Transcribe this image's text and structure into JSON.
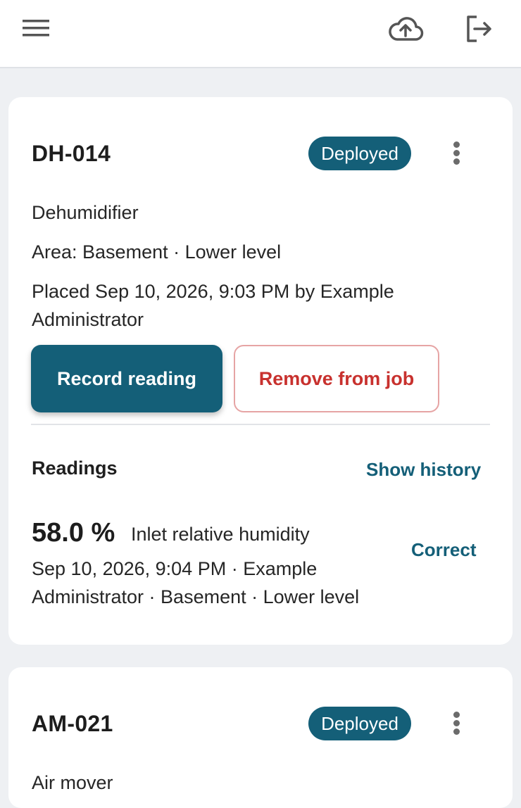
{
  "topbar": {
    "menu_icon": "hamburger-menu-icon",
    "upload_icon": "cloud-upload-icon",
    "logout_icon": "logout-icon"
  },
  "colors": {
    "accent": "#145f78",
    "danger": "#c8312e",
    "danger_border": "#e6a4a4",
    "background": "#eef0f3"
  },
  "cards": [
    {
      "id": "DH-014",
      "status": "Deployed",
      "type": "Dehumidifier",
      "area": "Area: Basement · Lower level",
      "placed_line1": "Placed Sep 10, 2026, 9:03 PM by Example",
      "placed_line2": "Administrator",
      "record_button": "Record reading",
      "remove_button": "Remove from job",
      "readings_title": "Readings",
      "show_history": "Show history",
      "reading": {
        "value": "58.0 %",
        "label": "Inlet relative humidity",
        "meta_line1": "Sep 10, 2026, 9:04 PM · Example",
        "meta_line2": "Administrator · Basement · Lower level",
        "correct": "Correct"
      }
    },
    {
      "id": "AM-021",
      "status": "Deployed",
      "type": "Air mover"
    }
  ]
}
